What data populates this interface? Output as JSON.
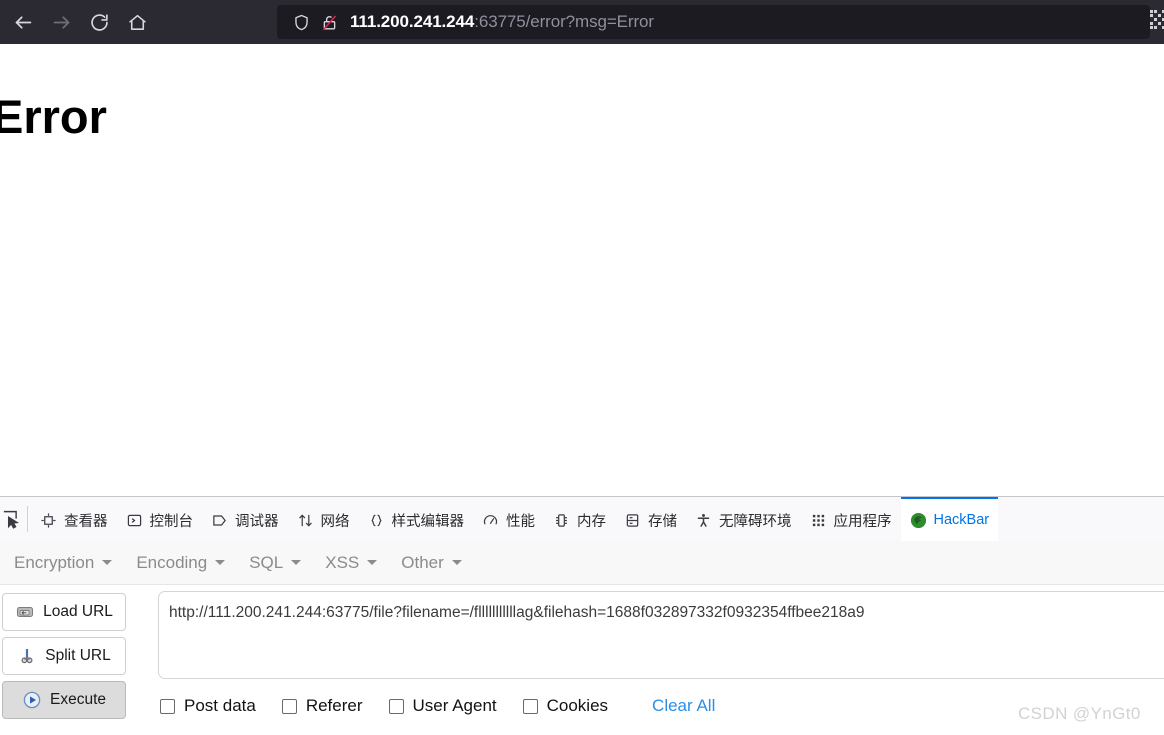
{
  "browser": {
    "nav": {
      "back_label": "Back",
      "forward_label": "Forward",
      "reload_label": "Reload",
      "home_label": "Home"
    },
    "urlbar": {
      "shield_label": "Tracking Protection",
      "lock_label": "Connection not secure",
      "url_host": "111.200.241.244",
      "url_rest": ":63775/error?msg=Error",
      "full_url": "111.200.241.244:63775/error?msg=Error"
    },
    "qr_label": "QR code"
  },
  "page": {
    "heading": "Error"
  },
  "devtools": {
    "picker_label": "Pick an element from the page",
    "tabs": [
      {
        "label": "查看器",
        "icon": "inspector-icon",
        "selected": false
      },
      {
        "label": "控制台",
        "icon": "console-icon",
        "selected": false
      },
      {
        "label": "调试器",
        "icon": "debugger-icon",
        "selected": false
      },
      {
        "label": "网络",
        "icon": "network-icon",
        "selected": false
      },
      {
        "label": "样式编辑器",
        "icon": "style-editor-icon",
        "selected": false
      },
      {
        "label": "性能",
        "icon": "performance-icon",
        "selected": false
      },
      {
        "label": "内存",
        "icon": "memory-icon",
        "selected": false
      },
      {
        "label": "存储",
        "icon": "storage-icon",
        "selected": false
      },
      {
        "label": "无障碍环境",
        "icon": "accessibility-icon",
        "selected": false
      },
      {
        "label": "应用程序",
        "icon": "application-icon",
        "selected": false
      },
      {
        "label": "HackBar",
        "icon": "hackbar-icon",
        "selected": true
      }
    ],
    "selected_tab_color": "#0074e8"
  },
  "hackbar": {
    "menus": [
      {
        "label": "Encryption"
      },
      {
        "label": "Encoding"
      },
      {
        "label": "SQL"
      },
      {
        "label": "XSS"
      },
      {
        "label": "Other"
      }
    ],
    "buttons": [
      {
        "label": "Load URL",
        "icon": "load-url-icon",
        "primary": false
      },
      {
        "label": "Split URL",
        "icon": "scissors-icon",
        "primary": false
      },
      {
        "label": "Execute",
        "icon": "play-icon",
        "primary": true
      }
    ],
    "url_value": "http://111.200.241.244:63775/file?filename=/flllllllllllag&filehash=1688f032897332f0932354ffbee218a9",
    "url_placeholder": "",
    "options": [
      {
        "label": "Post data",
        "checked": false
      },
      {
        "label": "Referer",
        "checked": false
      },
      {
        "label": "User Agent",
        "checked": false
      },
      {
        "label": "Cookies",
        "checked": false
      }
    ],
    "clear_all_label": "Clear All",
    "link_color": "#2a8fe8"
  },
  "watermark": "CSDN @YnGt0"
}
